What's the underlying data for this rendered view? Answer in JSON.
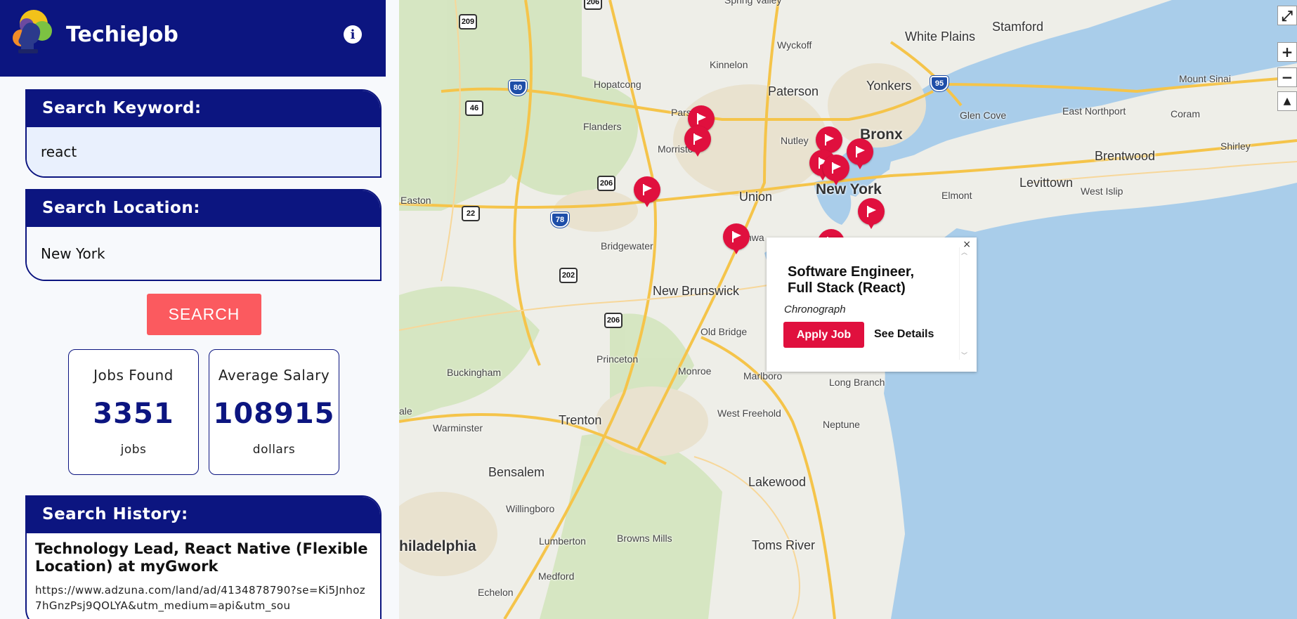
{
  "app": {
    "title": "TechieJob"
  },
  "search": {
    "keyword_label": "Search Keyword:",
    "keyword_value": "react",
    "location_label": "Search Location:",
    "location_value": "New York",
    "button_label": "SEARCH"
  },
  "stats": {
    "jobs": {
      "label": "Jobs Found",
      "value": "3351",
      "unit": "jobs"
    },
    "salary": {
      "label": "Average Salary",
      "value": "108915",
      "unit": "dollars"
    }
  },
  "history": {
    "label": "Search History:",
    "title": "Technology Lead, React Native (Flexible Location) at myGwork",
    "url": "https://www.adzuna.com/land/ad/4134878790?se=Ki5Jnhoz7hGnzPsj9QOLYA&utm_medium=api&utm_sou"
  },
  "popup": {
    "title": "Software Engineer, Full Stack (React)",
    "company": "Chronograph",
    "apply_label": "Apply Job",
    "details_label": "See Details",
    "close_glyph": "×"
  },
  "map": {
    "controls": {
      "zoom_in": "+",
      "zoom_out": "−",
      "fullscreen_icon": "expand-icon",
      "compass_icon": "compass-icon"
    },
    "places": {
      "spring_valley": "Spring Valley",
      "white_plains": "White Plains",
      "stamford": "Stamford",
      "wyckoff": "Wyckoff",
      "kinnelon": "Kinnelon",
      "paterson": "Paterson",
      "yonkers": "Yonkers",
      "mount_sinai": "Mount Sinai",
      "hopatcong": "Hopatcong",
      "glen_cove": "Glen Cove",
      "east_northport": "East Northport",
      "coram": "Coram",
      "parsippany": "Pars",
      "flanders": "Flanders",
      "bronx": "Bronx",
      "nutley": "Nutley",
      "morristown": "Morristo",
      "brentwood": "Brentwood",
      "shirley": "Shirley",
      "levittown": "Levittown",
      "west_islip": "West Islip",
      "elmont": "Elmont",
      "easton": "Easton",
      "union": "Union",
      "new_york": "New York",
      "bridgewater": "Bridgewater",
      "new_brunswick": "New Brunswick",
      "old_bridge": "Old Bridge",
      "long_branch": "Long Branch",
      "buckingham": "Buckingham",
      "princeton": "Princeton",
      "monroe": "Monroe",
      "marlboro": "Marlboro",
      "west_freehold": "West Freehold",
      "ale": "ale",
      "trenton": "Trenton",
      "warminster": "Warminster",
      "neptune": "Neptune",
      "bensalem": "Bensalem",
      "lakewood": "Lakewood",
      "willingboro": "Willingboro",
      "lumberton": "Lumberton",
      "browns_mills": "Browns Mills",
      "toms_river": "Toms River",
      "philadelphia": "hiladelphia",
      "medford": "Medford",
      "echelon": "Echelon",
      "rahway": "nwa"
    },
    "shields": {
      "r209": "209",
      "r206a": "206",
      "i80": "80",
      "r46": "46",
      "i95": "95",
      "r206b": "206",
      "r22": "22",
      "i78": "78",
      "r202": "202",
      "r206c": "206"
    }
  },
  "colors": {
    "brand": "#0c1580",
    "accent": "#fb5a5f",
    "marker": "#e0103e",
    "water": "#a9cdea",
    "land": "#eeeee8"
  }
}
